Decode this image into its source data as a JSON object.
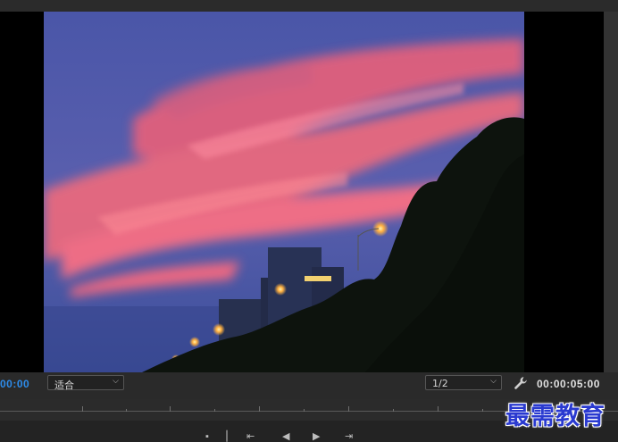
{
  "program_monitor": {
    "current_timecode": "00:00",
    "fit_dropdown": {
      "selected": "适合"
    },
    "resolution_dropdown": {
      "selected": "1/2"
    },
    "duration_timecode": "00:00:05:00",
    "frame_content": "sunset-sky-with-pink-clouds-buildings-trees",
    "icons": {
      "fit_chevron": "chevron-down-icon",
      "resolution_chevron": "chevron-down-icon",
      "settings": "wrench-icon",
      "transport": [
        "marker-icon",
        "in-point-icon",
        "go-to-in-icon",
        "step-back-icon",
        "play-icon",
        "step-forward-icon",
        "go-to-out-icon"
      ]
    }
  },
  "watermark": {
    "text": "最需教育"
  },
  "colors": {
    "timecode_accent": "#2d8ceb",
    "panel_bg": "#232323",
    "watermark": "#2a3ad0"
  }
}
